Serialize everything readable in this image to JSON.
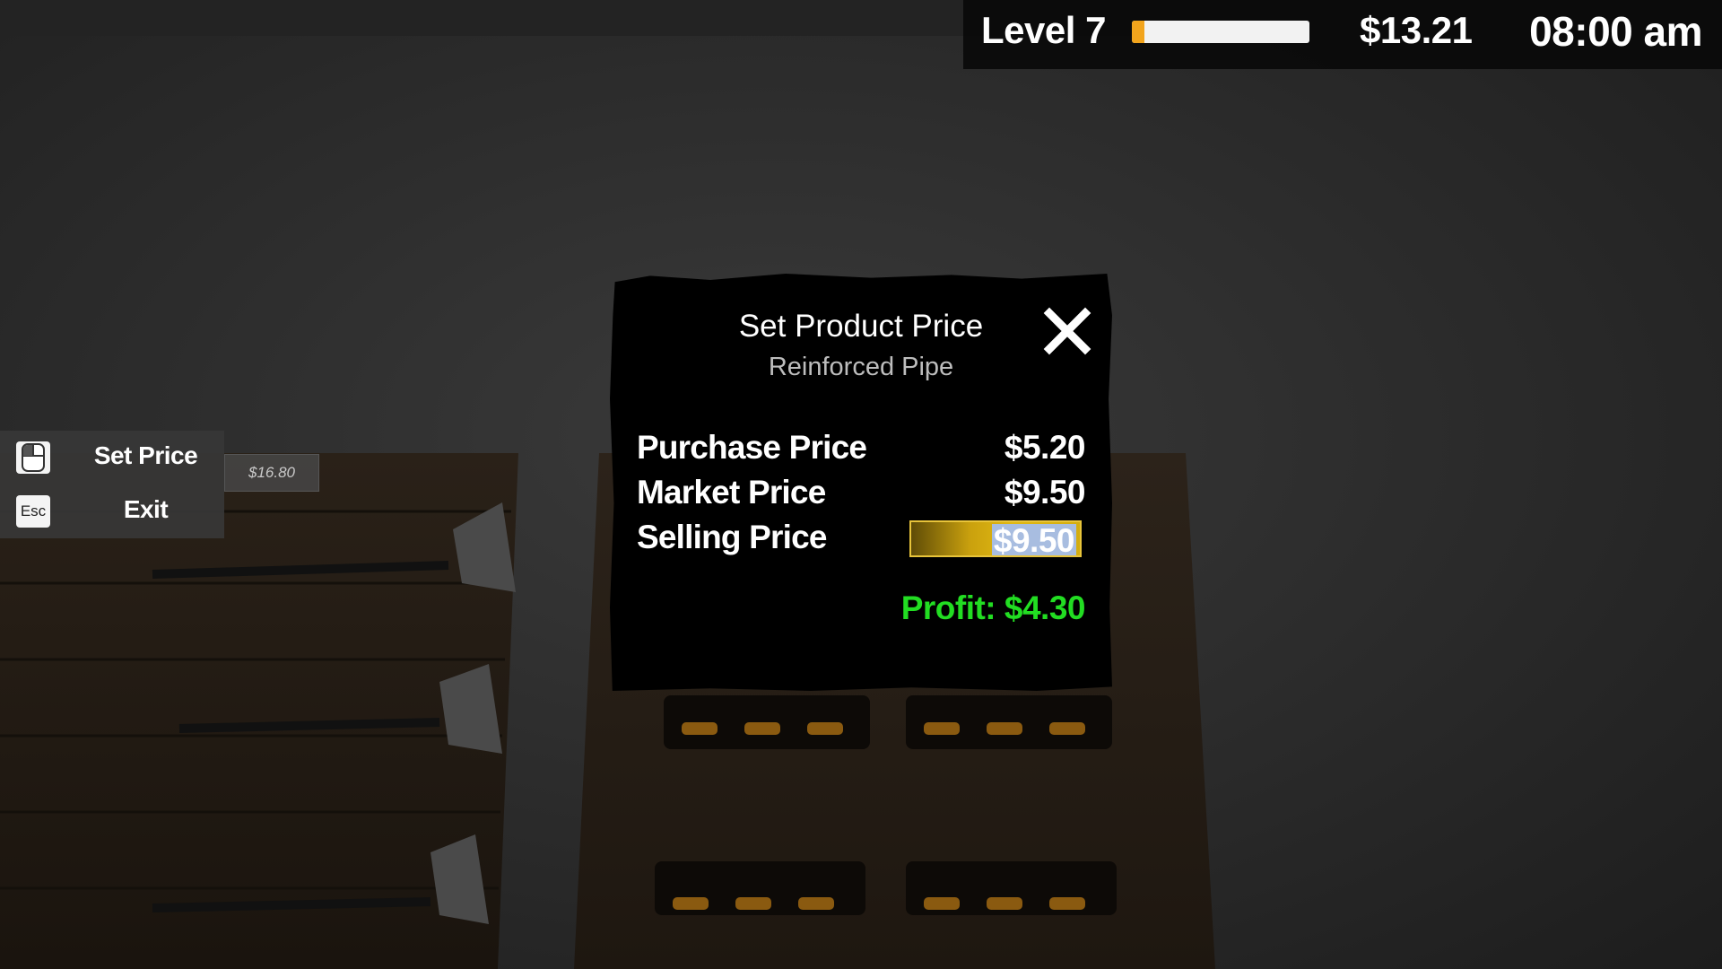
{
  "hud": {
    "level": "Level 7",
    "xp_progress": 0.07,
    "money": "$13.21",
    "time": "08:00 am"
  },
  "hints": [
    {
      "key": "",
      "key_icon": "mouse-left-click-icon",
      "label": "Set Price"
    },
    {
      "key": "Esc",
      "label": "Exit"
    }
  ],
  "shelf_price_tag": "$16.80",
  "dialog": {
    "title": "Set Product Price",
    "subtitle": "Reinforced Pipe",
    "rows": [
      {
        "label": "Purchase Price",
        "value": "$5.20"
      },
      {
        "label": "Market Price",
        "value": "$9.50"
      }
    ],
    "selling": {
      "label": "Selling Price",
      "value": "$9.50"
    },
    "profit": "Profit: $4.30",
    "close_icon": "close-icon"
  },
  "colors": {
    "xp_fill": "#f2a41c",
    "profit": "#22dd22",
    "selling_field": "#d8b010",
    "selection": "#a8bde0"
  }
}
